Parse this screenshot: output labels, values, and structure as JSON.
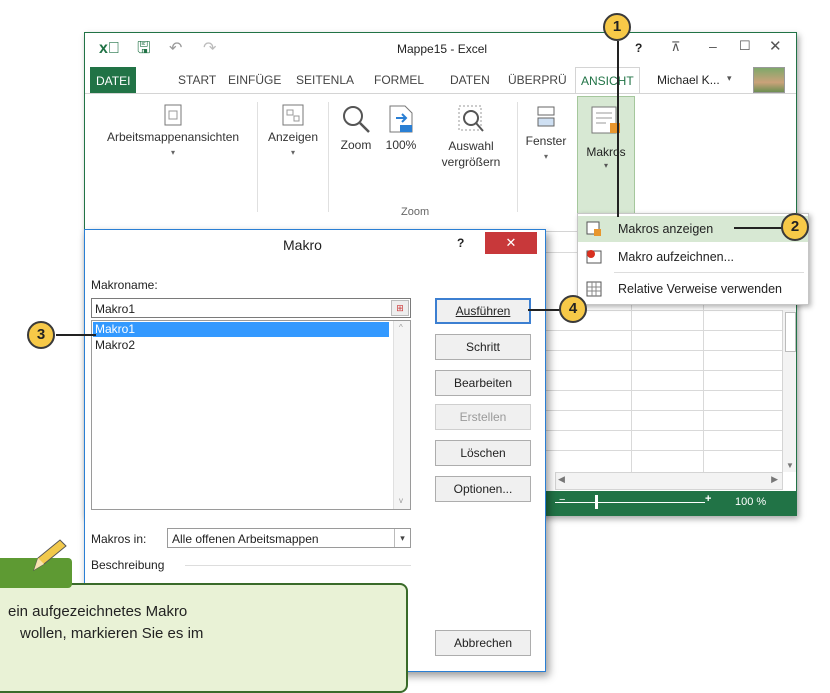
{
  "window": {
    "title": "Mappe15 - Excel",
    "help": "?",
    "user": "Michael K...",
    "tabs": [
      "DATEI",
      "START",
      "EINFÜGE",
      "SEITENLA",
      "FORMEL",
      "DATEN",
      "ÜBERPRÜ",
      "ANSICHT"
    ]
  },
  "ribbon": {
    "items": [
      "Arbeitsmappenansichten",
      "Anzeigen",
      "Zoom",
      "100%",
      "Auswahl vergrößern",
      "Fenster",
      "Makros"
    ],
    "group_label": "Zoom"
  },
  "status": {
    "zoom": "100 %"
  },
  "menu": {
    "items": [
      "Makros anzeigen",
      "Makro aufzeichnen...",
      "Relative Verweise verwenden"
    ]
  },
  "dialog": {
    "title": "Makro",
    "help": "?",
    "name_label": "Makroname:",
    "name_value": "Makro1",
    "macros": [
      "Makro1",
      "Makro2"
    ],
    "buttons": [
      "Ausführen",
      "Schritt",
      "Bearbeiten",
      "Erstellen",
      "Löschen",
      "Optionen...",
      "Abbrechen"
    ],
    "in_label": "Makros in:",
    "in_value": "Alle offenen Arbeitsmappen",
    "desc_label": "Beschreibung"
  },
  "callouts": [
    "1",
    "2",
    "3",
    "4"
  ],
  "tip": {
    "line1": "ein aufgezeichnetes Makro",
    "line2": "wollen, markieren Sie es im"
  },
  "colors": {
    "excel_green": "#217346",
    "callout_fill": "#f7c948",
    "dialog_close": "#c8383a",
    "selection": "#3399ff"
  }
}
